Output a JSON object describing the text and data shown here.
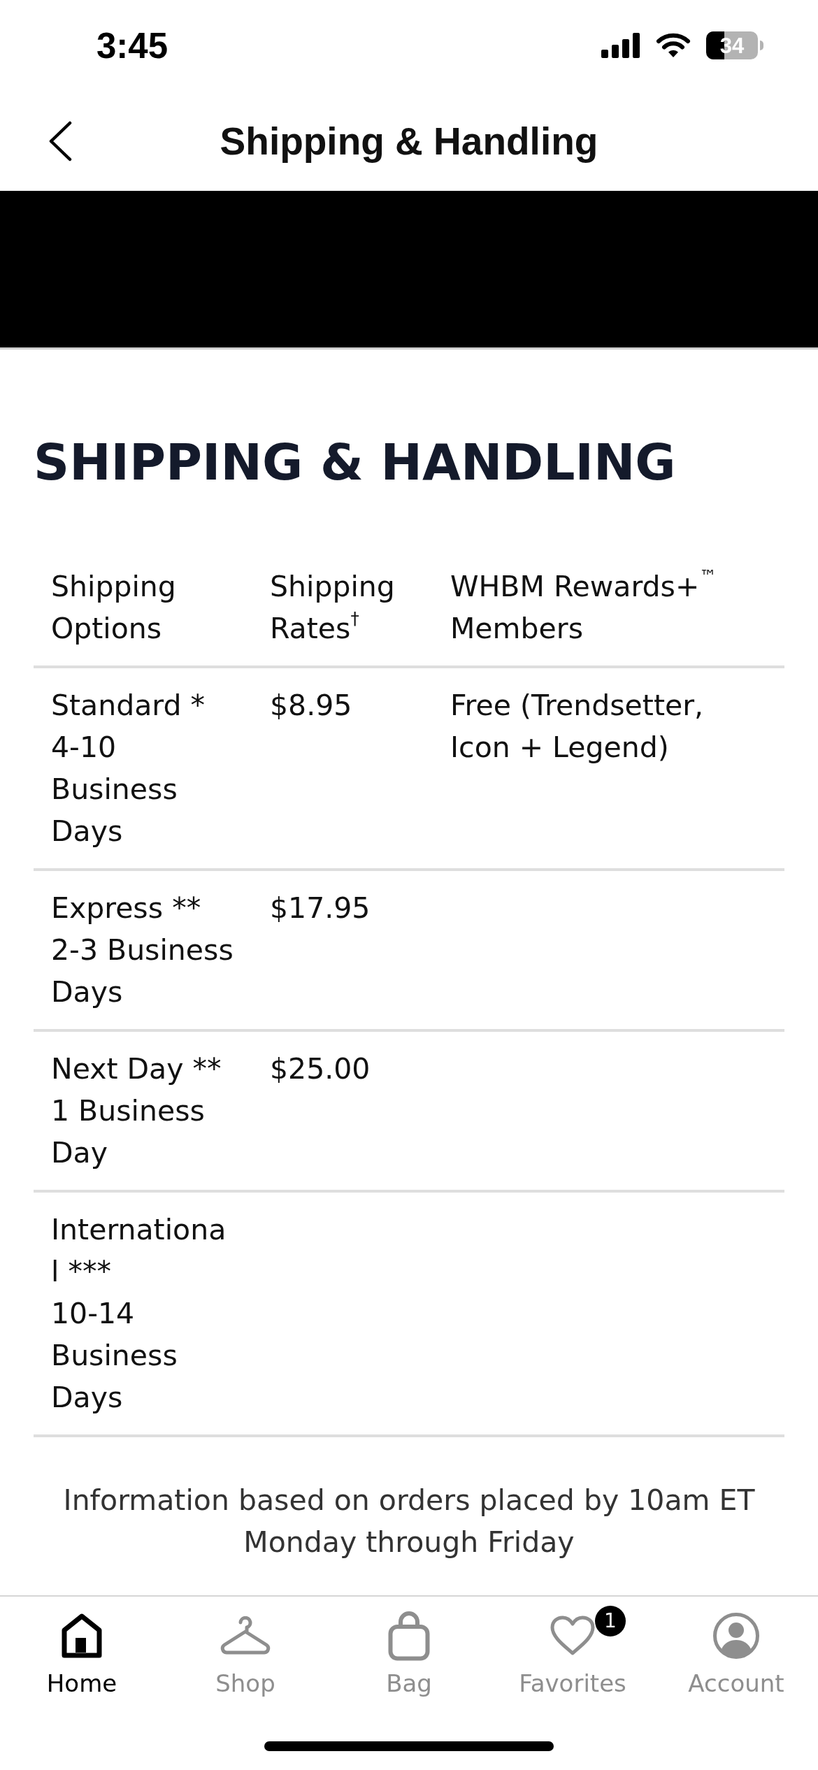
{
  "status_bar": {
    "time": "3:45",
    "battery": "34"
  },
  "nav": {
    "title": "Shipping & Handling"
  },
  "heading": "SHIPPING & HANDLING",
  "table": {
    "columns": [
      "Shipping\nOptions",
      "Shipping\nRates$^{†}$",
      "WHBM Rewards+$^{™}$\nMembers"
    ],
    "rows": [
      {
        "option": "Standard *\n4-10\nBusiness\nDays",
        "rate": "$8.95",
        "members": "Free (Trendsetter,\nIcon + Legend)"
      },
      {
        "option": "Express **\n2-3 Business\nDays",
        "rate": "$17.95"
      },
      {
        "option": "Next Day **\n1 Business\nDay",
        "rate": "$25.00"
      },
      {
        "option": "Internationa\nl ***\n10-14\nBusiness\nDays"
      }
    ]
  },
  "note": "Information based on orders placed by 10am ET Monday through Friday",
  "tabs": [
    {
      "label": "Home",
      "selected": true
    },
    {
      "label": "Shop",
      "selected": false
    },
    {
      "label": "Bag",
      "selected": false
    },
    {
      "label": "Favorites",
      "selected": false,
      "badge": "1"
    },
    {
      "label": "Account",
      "selected": false
    }
  ]
}
